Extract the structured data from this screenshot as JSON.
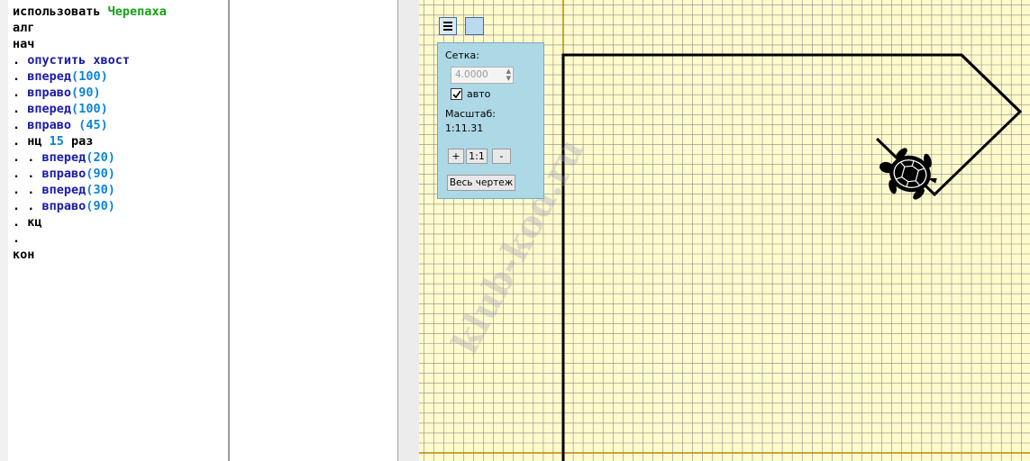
{
  "editor": {
    "lines": [
      [
        {
          "t": "использовать ",
          "c": "kw"
        },
        {
          "t": "Черепаха",
          "c": "mod"
        }
      ],
      [
        {
          "t": "алг",
          "c": "kw"
        }
      ],
      [
        {
          "t": "нач",
          "c": "kw"
        }
      ],
      [
        {
          "t": ". ",
          "c": "kw"
        },
        {
          "t": "опустить хвост",
          "c": "cmd"
        }
      ],
      [
        {
          "t": ". ",
          "c": "kw"
        },
        {
          "t": "вперед",
          "c": "cmd"
        },
        {
          "t": "(",
          "c": "num"
        },
        {
          "t": "100",
          "c": "num"
        },
        {
          "t": ")",
          "c": "num"
        }
      ],
      [
        {
          "t": ". ",
          "c": "kw"
        },
        {
          "t": "вправо",
          "c": "cmd"
        },
        {
          "t": "(",
          "c": "num"
        },
        {
          "t": "90",
          "c": "num"
        },
        {
          "t": ")",
          "c": "num"
        }
      ],
      [
        {
          "t": ". ",
          "c": "kw"
        },
        {
          "t": "вперед",
          "c": "cmd"
        },
        {
          "t": "(",
          "c": "num"
        },
        {
          "t": "100",
          "c": "num"
        },
        {
          "t": ")",
          "c": "num"
        }
      ],
      [
        {
          "t": ". ",
          "c": "kw"
        },
        {
          "t": "вправо",
          "c": "cmd"
        },
        {
          "t": " (",
          "c": "num"
        },
        {
          "t": "45",
          "c": "num"
        },
        {
          "t": ")",
          "c": "num"
        }
      ],
      [
        {
          "t": ". нц ",
          "c": "kw"
        },
        {
          "t": "15",
          "c": "num"
        },
        {
          "t": " раз",
          "c": "kw"
        }
      ],
      [
        {
          "t": ". . ",
          "c": "kw"
        },
        {
          "t": "вперед",
          "c": "cmd"
        },
        {
          "t": "(",
          "c": "num"
        },
        {
          "t": "20",
          "c": "num"
        },
        {
          "t": ")",
          "c": "num"
        }
      ],
      [
        {
          "t": ". . ",
          "c": "kw"
        },
        {
          "t": "вправо",
          "c": "cmd"
        },
        {
          "t": "(",
          "c": "num"
        },
        {
          "t": "90",
          "c": "num"
        },
        {
          "t": ")",
          "c": "num"
        }
      ],
      [
        {
          "t": ". . ",
          "c": "kw"
        },
        {
          "t": "вперед",
          "c": "cmd"
        },
        {
          "t": "(",
          "c": "num"
        },
        {
          "t": "30",
          "c": "num"
        },
        {
          "t": ")",
          "c": "num"
        }
      ],
      [
        {
          "t": ". . ",
          "c": "kw"
        },
        {
          "t": "вправо",
          "c": "cmd"
        },
        {
          "t": "(",
          "c": "num"
        },
        {
          "t": "90",
          "c": "num"
        },
        {
          "t": ")",
          "c": "num"
        }
      ],
      [
        {
          "t": ". кц",
          "c": "kw"
        }
      ],
      [
        {
          "t": ".",
          "c": "kw"
        }
      ],
      [
        {
          "t": "кон",
          "c": "kw"
        }
      ]
    ]
  },
  "panel": {
    "grid_label": "Сетка:",
    "grid_value": "4.0000",
    "auto_label": "авто",
    "auto_checked": true,
    "scale_label": "Масштаб:",
    "scale_value": "1:11.31",
    "zoom_in": "+",
    "zoom_reset": "1:1",
    "zoom_out": "-",
    "whole_drawing": "Весь чертеж"
  },
  "toolbar": {
    "menu_icon": "menu-icon",
    "square_icon": "square-icon"
  },
  "canvas": {
    "background": "#fffbcc",
    "grid_color": "#8c8c8c",
    "axis_color": "#b8860b",
    "path_color": "#000000"
  },
  "watermark": "klub-kod.ru"
}
